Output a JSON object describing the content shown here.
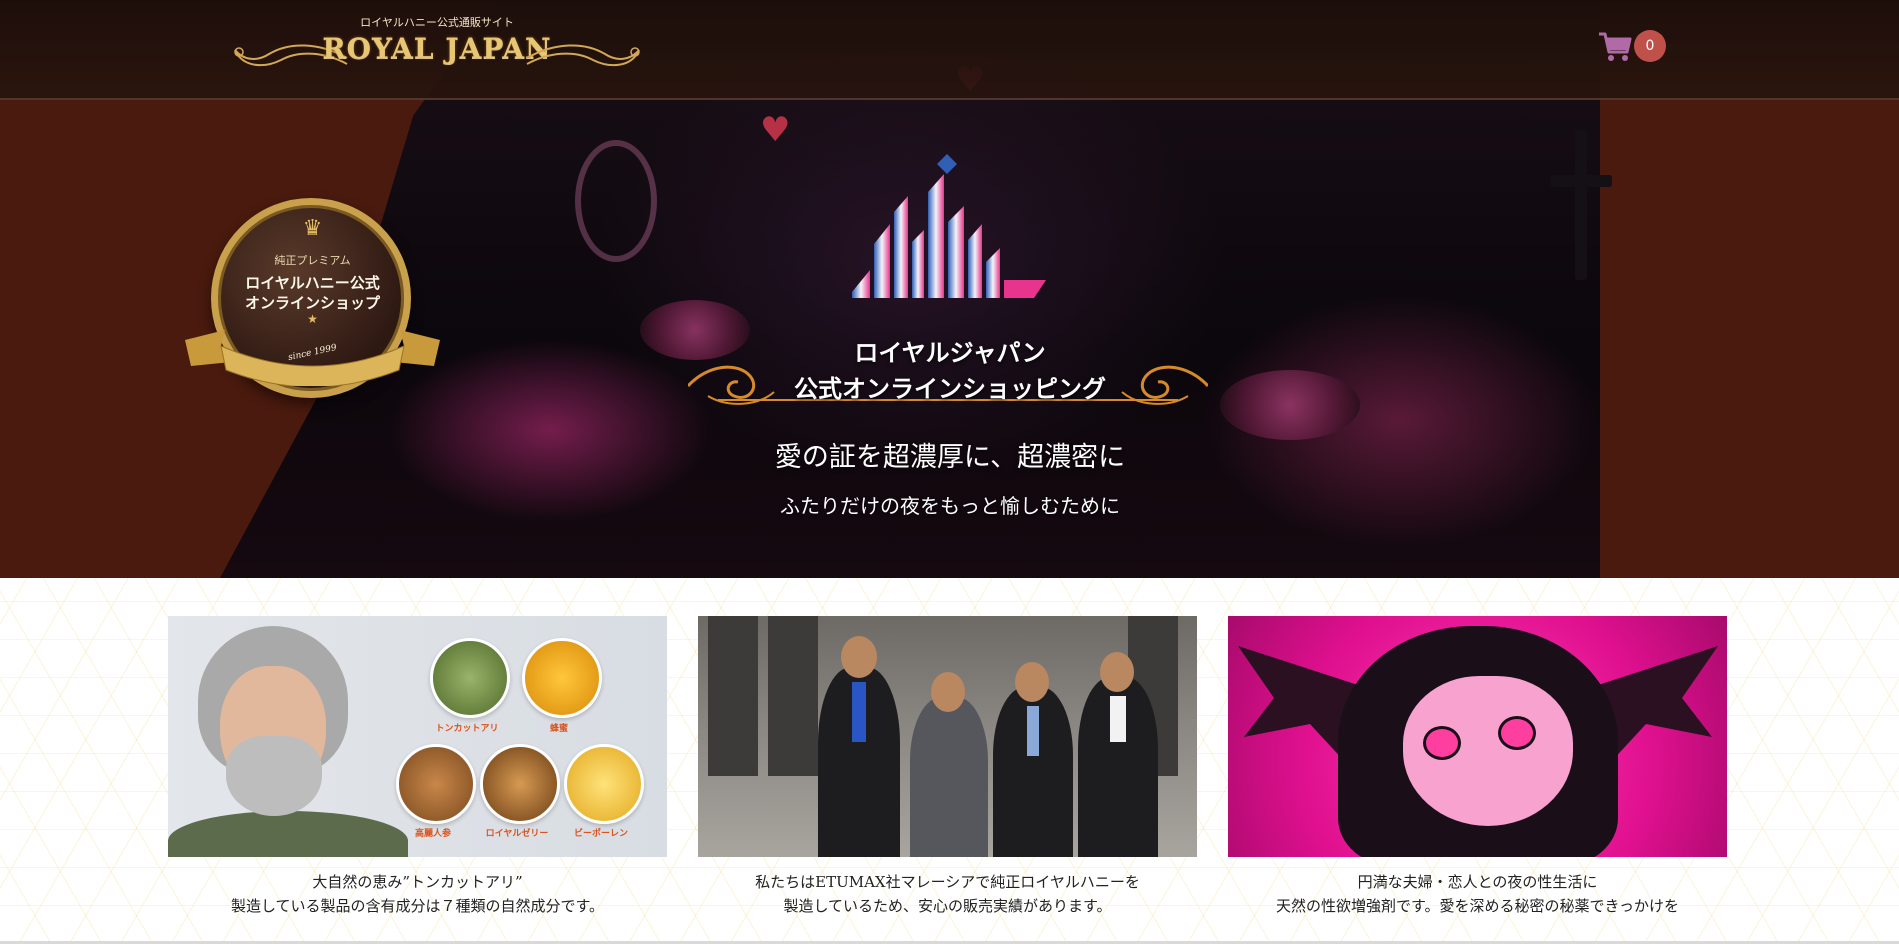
{
  "header": {
    "brand_subtitle": "ロイヤルハニー公式通販サイト",
    "brand_name": "ROYAL JAPAN",
    "cart_count": "0"
  },
  "hero": {
    "seal": {
      "kicker": "純正プレミアム",
      "line1": "ロイヤルハニー公式",
      "line2": "オンラインショップ",
      "since": "since 1999"
    },
    "title_line1": "ロイヤルジャパン",
    "title_line2": "公式オンラインショッピング",
    "tagline": "愛の証を超濃厚に、超濃密に",
    "subtitle": "ふたりだけの夜をもっと愉しむために"
  },
  "features": [
    {
      "ingredients": [
        "トンカットアリ",
        "蜂蜜",
        "高麗人参",
        "ロイヤルゼリー",
        "ビーポーレン"
      ],
      "caption_line1": "大自然の恵み”トンカットアリ”",
      "caption_line2": "製造している製品の含有成分は７種類の自然成分です。"
    },
    {
      "caption_line1": "私たちはETUMAX社マレーシアで純正ロイヤルハニーを",
      "caption_line2": "製造しているため、安心の販売実績があります。"
    },
    {
      "caption_line1": "円満な夫婦・恋人との夜の性生活に",
      "caption_line2": "天然の性欲増強剤です。愛を深める秘密の秘薬できっかけを"
    }
  ],
  "icons": {
    "cart": "shopping-cart-icon",
    "crown": "crown-icon",
    "star": "star-icon"
  },
  "colors": {
    "hero_background": "#4a1a0e",
    "cart_badge": "#c0504a",
    "cart_icon": "#b06aa8",
    "gold": "#e2bd62",
    "logo_blue": "#2f5fb7",
    "logo_pink": "#e8348c"
  }
}
